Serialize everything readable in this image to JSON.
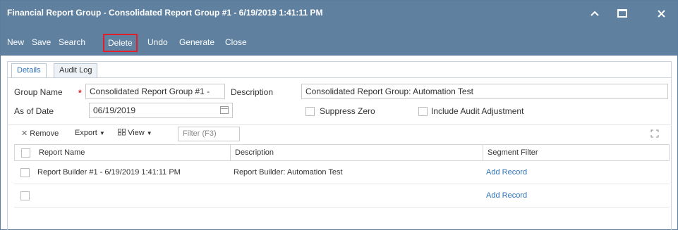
{
  "window": {
    "title": "Financial Report Group - Consolidated Report Group #1 - 6/19/2019 1:41:11 PM",
    "minimize_glyph": "⌃",
    "close_glyph": "✕"
  },
  "toolbar": {
    "new_label": "New",
    "save_label": "Save",
    "search_label": "Search",
    "delete_label": "Delete",
    "undo_label": "Undo",
    "generate_label": "Generate",
    "close_label": "Close"
  },
  "tabs": [
    {
      "label": "Details",
      "active": true
    },
    {
      "label": "Audit Log",
      "active": false
    }
  ],
  "form": {
    "group_name_label": "Group Name",
    "required_marker": "*",
    "group_name_value": "Consolidated Report Group #1 -",
    "description_label": "Description",
    "description_value": "Consolidated Report Group: Automation Test",
    "as_of_date_label": "As of Date",
    "as_of_date_value": "06/19/2019",
    "suppress_zero_label": "Suppress Zero",
    "suppress_zero_checked": false,
    "include_audit_label": "Include Audit Adjustment",
    "include_audit_checked": false
  },
  "grid_toolbar": {
    "remove_label": "Remove",
    "remove_icon": "✕",
    "export_label": "Export",
    "view_label": "View",
    "filter_placeholder": "Filter (F3)"
  },
  "grid": {
    "columns": [
      "Report Name",
      "Description",
      "Segment Filter"
    ],
    "rows": [
      {
        "report_name": "Report Builder #1 - 6/19/2019 1:41:11 PM",
        "description": "Report Builder: Automation Test",
        "segment_filter": "Add Record"
      },
      {
        "report_name": "",
        "description": "",
        "segment_filter": "Add Record"
      }
    ]
  },
  "colors": {
    "header_bg": "#5f809f",
    "accent_link": "#2f72b8",
    "highlight_border": "#e01f2a",
    "required": "#e02020"
  }
}
